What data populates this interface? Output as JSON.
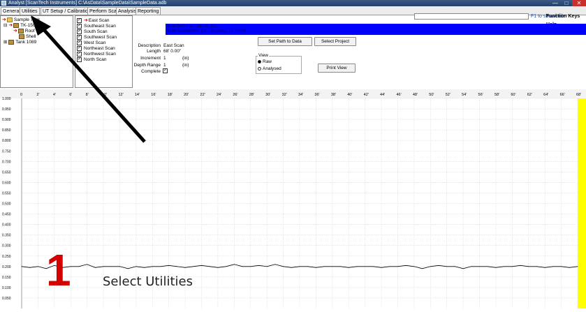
{
  "window": {
    "title": "Analyst [ScanTech Instruments]  C:\\AsData\\SampleData\\SampleData.adb",
    "minimize_glyph": "—",
    "maximize_glyph": "□",
    "close_glyph": "✕"
  },
  "tabs": [
    {
      "label": "General",
      "active": true
    },
    {
      "label": "Utilities",
      "active": false
    },
    {
      "label": "UT Setup / Calibration",
      "active": false
    },
    {
      "label": "Perform Scan",
      "active": false
    },
    {
      "label": "Analysis",
      "active": false
    },
    {
      "label": "Reporting",
      "active": false
    }
  ],
  "help": {
    "f1_hint": "F1 to show/hide",
    "function_keys": "Function Keys Help"
  },
  "tree": {
    "nodes": [
      {
        "label": "Sample Tank",
        "level": 0,
        "icon": "folder-icon"
      },
      {
        "label": "TK-1501",
        "level": 1,
        "icon": "tank-icon"
      },
      {
        "label": "Roof",
        "level": 2,
        "icon": "tank-icon"
      },
      {
        "label": "Shell",
        "level": 2,
        "icon": "tank-icon"
      },
      {
        "label": "Tank 1089",
        "level": 1,
        "icon": "tank-icon"
      }
    ]
  },
  "scans": [
    "East Scan",
    "Southeast Scan",
    "South Scan",
    "Southwest Scan",
    "West Scan",
    "Northeast Scan",
    "Northwest Scan",
    "North Scan"
  ],
  "banner": {
    "line1": "ScanTech Instruments, Inc.",
    "line2": "1234 Somewhere Cir. Longview, TX 75604"
  },
  "details": {
    "description_label": "Description",
    "description_value": "East Scan",
    "length_label": "Length",
    "length_value": "68'  0.00\"",
    "increment_label": "Increment",
    "increment_value": "1",
    "increment_unit": "(in)",
    "depth_label": "Depth Range",
    "depth_value": "1",
    "depth_unit": "(in)",
    "complete_label": "Complete",
    "complete_checked": "✓"
  },
  "buttons": {
    "set_path": "Set Path to Data",
    "select_project": "Select Project",
    "print_view": "Print View"
  },
  "view": {
    "legend": "View",
    "raw_label": "Raw",
    "analysed_label": "Analysed",
    "selected": "Raw"
  },
  "annotation": {
    "number": "1",
    "text": "Select Utilities"
  },
  "chart_data": {
    "type": "line",
    "x_unit_ticks": [
      "0",
      "2'",
      "4'",
      "6'",
      "8'",
      "10'",
      "12'",
      "14'",
      "16'",
      "18'",
      "20'",
      "22'",
      "24'",
      "26'",
      "28'",
      "30'",
      "32'",
      "34'",
      "36'",
      "38'",
      "40'",
      "42'",
      "44'",
      "46'",
      "48'",
      "50'",
      "52'",
      "54'",
      "56'",
      "58'",
      "60'",
      "62'",
      "64'",
      "66'",
      "68'"
    ],
    "xlim": [
      0,
      68
    ],
    "ylim": [
      0.0,
      1.0
    ],
    "y_ticks": [
      "1.000",
      "0.950",
      "0.900",
      "0.850",
      "0.800",
      "0.750",
      "0.700",
      "0.650",
      "0.600",
      "0.550",
      "0.500",
      "0.450",
      "0.400",
      "0.350",
      "0.300",
      "0.250",
      "0.200",
      "0.150",
      "0.100",
      "0.050"
    ],
    "grid": true,
    "series": [
      {
        "color": "#000000",
        "x": [
          0,
          1,
          2,
          3,
          4,
          5,
          6,
          7,
          8,
          9,
          10,
          11,
          12,
          13,
          14,
          15,
          16,
          17,
          18,
          19,
          20,
          21,
          22,
          23,
          24,
          25,
          26,
          27,
          28,
          29,
          30,
          31,
          32,
          33,
          34,
          35,
          36,
          37,
          38,
          39,
          40,
          41,
          42,
          43,
          44,
          45,
          46,
          47,
          48,
          49,
          50,
          51,
          52,
          53,
          54,
          55,
          56,
          57,
          58,
          59,
          60,
          61,
          62,
          63,
          64,
          65,
          66,
          67,
          68
        ],
        "values": [
          0.2,
          0.195,
          0.2,
          0.19,
          0.205,
          0.195,
          0.2,
          0.2,
          0.21,
          0.195,
          0.2,
          0.2,
          0.2,
          0.19,
          0.2,
          0.195,
          0.2,
          0.2,
          0.205,
          0.2,
          0.195,
          0.2,
          0.205,
          0.2,
          0.195,
          0.2,
          0.21,
          0.2,
          0.2,
          0.205,
          0.2,
          0.21,
          0.2,
          0.195,
          0.2,
          0.2,
          0.195,
          0.2,
          0.2,
          0.2,
          0.195,
          0.2,
          0.2,
          0.2,
          0.195,
          0.2,
          0.2,
          0.205,
          0.2,
          0.19,
          0.2,
          0.205,
          0.2,
          0.2,
          0.19,
          0.2,
          0.2,
          0.2,
          0.195,
          0.2,
          0.2,
          0.205,
          0.2,
          0.2,
          0.195,
          0.2,
          0.2,
          0.195,
          0.2
        ]
      }
    ],
    "right_marker_color": "#ffff00"
  }
}
